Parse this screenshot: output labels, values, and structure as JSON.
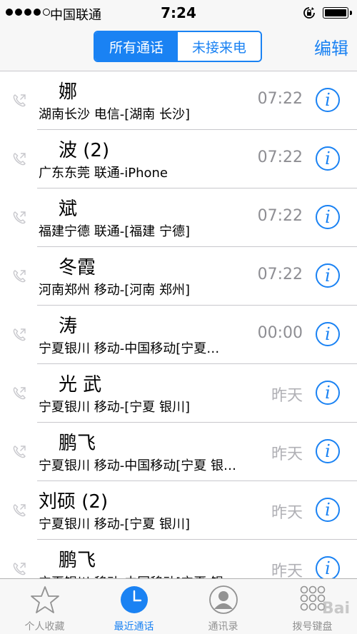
{
  "status_bar": {
    "carrier": "中国联通",
    "time": "7:24"
  },
  "header": {
    "segments": [
      "所有通话",
      "未接来电"
    ],
    "edit_label": "编辑"
  },
  "calls": [
    {
      "name": "娜",
      "detail": "湖南长沙 电信-[湖南 长沙]",
      "time": "07:22"
    },
    {
      "name": "波 (2)",
      "detail": "广东东莞 联通-iPhone",
      "time": "07:22"
    },
    {
      "name": "斌",
      "detail": "福建宁德 联通-[福建 宁德]",
      "time": "07:22"
    },
    {
      "name": "冬霞",
      "detail": "河南郑州 移动-[河南 郑州]",
      "time": "07:22"
    },
    {
      "name": "涛",
      "detail": "宁夏银川 移动-中国移动[宁夏…",
      "time": "00:00"
    },
    {
      "name": "光 武",
      "detail": "宁夏银川 移动-[宁夏 银川]",
      "time": "昨天"
    },
    {
      "name": "鹏飞",
      "detail": "宁夏银川 移动-中国移动[宁夏 银…",
      "time": "昨天"
    },
    {
      "name": "刘硕 (2)",
      "detail": "宁夏银川 移动-[宁夏 银川]",
      "time": "昨天"
    },
    {
      "name": "鹏飞",
      "detail": "宁夏银川 移动-中国移动[宁夏 银…",
      "time": "昨天"
    }
  ],
  "info_glyph": "i",
  "tabs": [
    {
      "label": "个人收藏",
      "icon": "star-icon"
    },
    {
      "label": "最近通话",
      "icon": "clock-icon"
    },
    {
      "label": "通讯录",
      "icon": "contacts-icon"
    },
    {
      "label": "拨号键盘",
      "icon": "keypad-icon"
    }
  ],
  "watermark": "Bai"
}
